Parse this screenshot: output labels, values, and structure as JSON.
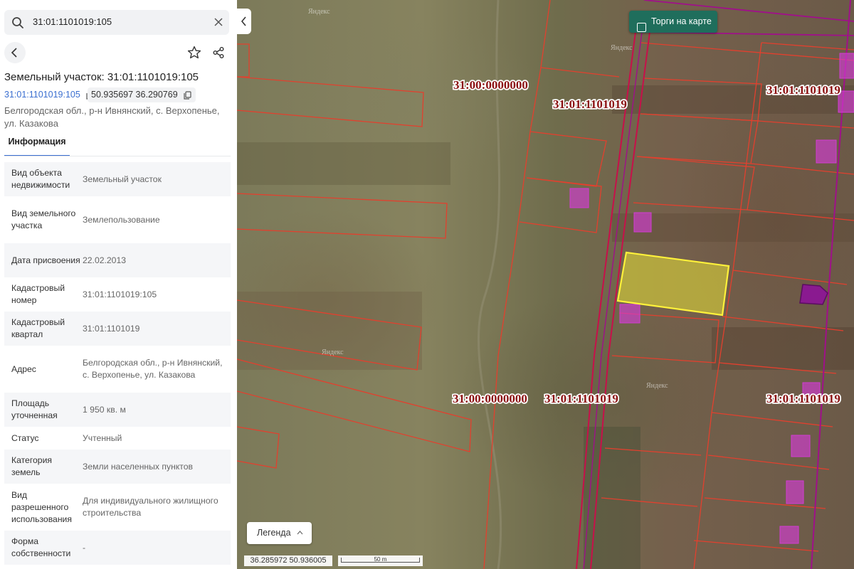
{
  "search": {
    "value": "31:01:1101019:105"
  },
  "panel": {
    "title": "Земельный участок: 31:01:1101019:105",
    "cadastral_number": "31:01:1101019:105",
    "coordinates": "50.935697 36.290769",
    "address": "Белгородская обл., р-н Ивнянский, с. Верхопенье, ул. Казакова",
    "tab_info": "Информация",
    "properties": [
      {
        "key": "Вид объекта недвижимости",
        "value": "Земельный участок"
      },
      {
        "key": "Вид земельного участка",
        "value": "Землепользование"
      },
      {
        "key": "Дата присвоения",
        "value": "22.02.2013"
      },
      {
        "key": "Кадастровый номер",
        "value": "31:01:1101019:105"
      },
      {
        "key": "Кадастровый квартал",
        "value": "31:01:1101019"
      },
      {
        "key": "Адрес",
        "value": "Белгородская обл., р-н Ивнянский, с. Верхопенье, ул. Казакова"
      },
      {
        "key": "Площадь уточненная",
        "value": "1 950 кв. м"
      },
      {
        "key": "Статус",
        "value": "Учтенный"
      },
      {
        "key": "Категория земель",
        "value": "Земли населенных пунктов"
      },
      {
        "key": "Вид разрешенного использования",
        "value": "Для индивидуального жилищного строительства"
      },
      {
        "key": "Форма собственности",
        "value": "-"
      }
    ]
  },
  "map": {
    "torgi_label": "Торги на карте",
    "legend_label": "Легенда",
    "cursor_coords": "36.285972  50.936005",
    "scale_label": "50 m",
    "watermark": "Яндекс",
    "quarter_labels": [
      {
        "text": "31:00:0000000"
      },
      {
        "text": "31:01:1101019"
      },
      {
        "text": "31:01:1101019"
      },
      {
        "text": "31:00:0000000"
      },
      {
        "text": "31:01:1101019"
      },
      {
        "text": "31:01:1101019"
      }
    ],
    "colors": {
      "parcel_outline": "#e2402e",
      "quarter_boundary": "#c8104a",
      "road_boundary": "#a0108a",
      "building_fill": "#d23cd2",
      "selected_fill": "#e6e037",
      "selected_outline": "#fff23a",
      "label_text": "#8a0f0f"
    }
  }
}
